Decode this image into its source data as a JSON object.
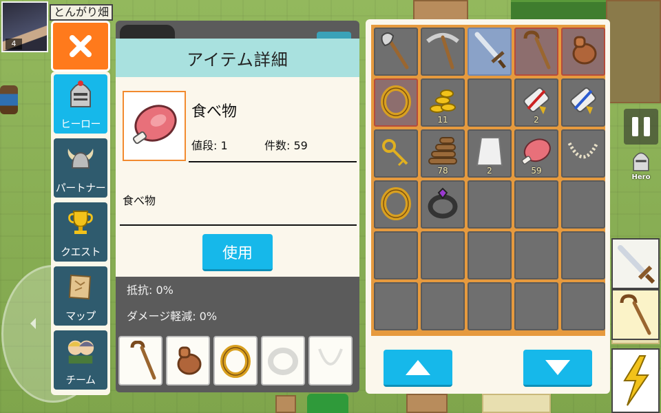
{
  "player": {
    "name": "とんがり畑",
    "level": "4"
  },
  "menu": {
    "close_icon": "close-icon",
    "items": [
      {
        "label": "ヒーロー",
        "icon": "knight-helmet-icon",
        "active": true
      },
      {
        "label": "パートナー",
        "icon": "viking-helmet-icon",
        "active": false
      },
      {
        "label": "クエスト",
        "icon": "trophy-icon",
        "active": false
      },
      {
        "label": "マップ",
        "icon": "map-scroll-icon",
        "active": false
      },
      {
        "label": "チーム",
        "icon": "team-portrait-icon",
        "active": false
      }
    ]
  },
  "detail": {
    "title": "アイテム詳細",
    "item_name": "食べ物",
    "price_label": "値段: 1",
    "count_label": "件数: 59",
    "description": "食べ物",
    "use_button": "使用",
    "item_icon": "meat-icon"
  },
  "stats": {
    "resist": "抵抗: 0%",
    "damage_reduction": "ダメージ軽減: 0%"
  },
  "equipped_slots": [
    {
      "icon": "staff-icon",
      "empty": false
    },
    {
      "icon": "amulet-icon",
      "empty": false
    },
    {
      "icon": "ring-icon",
      "empty": false
    },
    {
      "icon": "bracelet-icon",
      "empty": true
    },
    {
      "icon": "necklace-icon",
      "empty": true
    }
  ],
  "inventory": [
    {
      "icon": "axe-icon",
      "count": "",
      "state": "normal"
    },
    {
      "icon": "pickaxe-icon",
      "count": "",
      "state": "normal"
    },
    {
      "icon": "sword-icon",
      "count": "",
      "state": "selected"
    },
    {
      "icon": "staff-icon",
      "count": "",
      "state": "equipped"
    },
    {
      "icon": "amulet-icon",
      "count": "",
      "state": "equipped"
    },
    {
      "icon": "ring-icon",
      "count": "",
      "state": "equipped"
    },
    {
      "icon": "gold-coins-icon",
      "count": "11",
      "state": "normal"
    },
    {
      "icon": "",
      "count": "",
      "state": "normal"
    },
    {
      "icon": "scroll-red-icon",
      "count": "2",
      "state": "normal"
    },
    {
      "icon": "scroll-blue-icon",
      "count": "",
      "state": "normal"
    },
    {
      "icon": "key-icon",
      "count": "",
      "state": "normal"
    },
    {
      "icon": "wood-logs-icon",
      "count": "78",
      "state": "normal"
    },
    {
      "icon": "stone-block-icon",
      "count": "2",
      "state": "normal"
    },
    {
      "icon": "meat-icon",
      "count": "59",
      "state": "normal"
    },
    {
      "icon": "necklace-icon",
      "count": "",
      "state": "normal"
    },
    {
      "icon": "ring-icon",
      "count": "",
      "state": "normal"
    },
    {
      "icon": "dark-ring-icon",
      "count": "",
      "state": "normal"
    },
    {
      "icon": "",
      "count": "",
      "state": "normal"
    },
    {
      "icon": "",
      "count": "",
      "state": "normal"
    },
    {
      "icon": "",
      "count": "",
      "state": "normal"
    },
    {
      "icon": "",
      "count": "",
      "state": "normal"
    },
    {
      "icon": "",
      "count": "",
      "state": "normal"
    },
    {
      "icon": "",
      "count": "",
      "state": "normal"
    },
    {
      "icon": "",
      "count": "",
      "state": "normal"
    },
    {
      "icon": "",
      "count": "",
      "state": "normal"
    },
    {
      "icon": "",
      "count": "",
      "state": "normal"
    },
    {
      "icon": "",
      "count": "",
      "state": "normal"
    },
    {
      "icon": "",
      "count": "",
      "state": "normal"
    },
    {
      "icon": "",
      "count": "",
      "state": "normal"
    },
    {
      "icon": "",
      "count": "",
      "state": "normal"
    }
  ],
  "hud": {
    "hero_label": "Hero",
    "pause_icon": "pause-icon"
  },
  "colors": {
    "accent": "#16b8ea",
    "close": "#ff7a1c",
    "header": "#a9e1df",
    "grid": "#e69a3e"
  }
}
